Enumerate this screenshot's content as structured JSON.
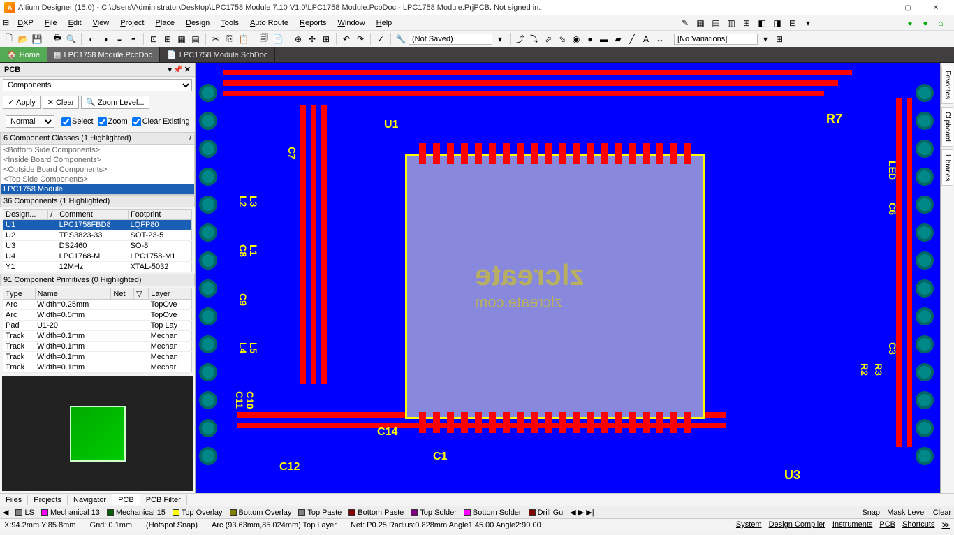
{
  "title": "Altium Designer (15.0) - C:\\Users\\Administrator\\Desktop\\LPC1758 Module 7.10 V1.0\\LPC1758 Module.PcbDoc - LPC1758 Module.PrjPCB. Not signed in.",
  "menus": [
    "DXP",
    "File",
    "Edit",
    "View",
    "Project",
    "Place",
    "Design",
    "Tools",
    "Auto Route",
    "Reports",
    "Window",
    "Help"
  ],
  "toolbar2": {
    "notsaved": "(Not Saved)",
    "novar": "[No Variations]"
  },
  "doctabs": {
    "home": "Home",
    "t1": "LPC1758 Module.PcbDoc",
    "t2": "LPC1758 Module.SchDoc"
  },
  "panel": {
    "title": "PCB",
    "mode": "Components",
    "apply": "Apply",
    "clear": "Clear",
    "zoom": "Zoom Level...",
    "normal": "Normal",
    "select": "Select",
    "zoom2": "Zoom",
    "clearex": "Clear Existing",
    "classes_hdr": "6 Component Classes (1 Highlighted)",
    "classes": [
      "<Bottom Side Components>",
      "<Inside Board Components>",
      "<Outside Board Components>",
      "<Top Side Components>",
      "LPC1758 Module"
    ],
    "comps_hdr": "36 Components (1 Highlighted)",
    "comp_cols": [
      "Design...",
      "Comment",
      "Footprint"
    ],
    "comps": [
      {
        "d": "U1",
        "c": "LPC1758FBD8",
        "f": "LQFP80",
        "sel": true
      },
      {
        "d": "U2",
        "c": "TPS3823-33",
        "f": "SOT-23-5"
      },
      {
        "d": "U3",
        "c": "DS2460",
        "f": "SO-8"
      },
      {
        "d": "U4",
        "c": "LPC1768-M",
        "f": "LPC1758-M1"
      },
      {
        "d": "Y1",
        "c": "12MHz",
        "f": "XTAL-5032"
      }
    ],
    "prims_hdr": "91 Component Primitives (0 Highlighted)",
    "prim_cols": [
      "Type",
      "Name",
      "Net",
      "Layer"
    ],
    "prims": [
      {
        "t": "Arc",
        "n": "Width=0.25mm",
        "e": "",
        "l": "TopOve"
      },
      {
        "t": "Arc",
        "n": "Width=0.5mm",
        "e": "",
        "l": "TopOve"
      },
      {
        "t": "Pad",
        "n": "U1-20",
        "e": "",
        "l": "Top Lay"
      },
      {
        "t": "Track",
        "n": "Width=0.1mm",
        "e": "",
        "l": "Mechan"
      },
      {
        "t": "Track",
        "n": "Width=0.1mm",
        "e": "",
        "l": "Mechan"
      },
      {
        "t": "Track",
        "n": "Width=0.1mm",
        "e": "",
        "l": "Mechan"
      },
      {
        "t": "Track",
        "n": "Width=0.1mm",
        "e": "",
        "l": "Mechar"
      }
    ]
  },
  "bottabs": [
    "Files",
    "Projects",
    "Navigator",
    "PCB",
    "PCB Filter"
  ],
  "bottabs_active": 3,
  "layers": [
    {
      "n": "LS",
      "c": "#808080"
    },
    {
      "n": "Mechanical 13",
      "c": "#ff00ff"
    },
    {
      "n": "Mechanical 15",
      "c": "#006000"
    },
    {
      "n": "Top Overlay",
      "c": "#ffff00"
    },
    {
      "n": "Bottom Overlay",
      "c": "#808000"
    },
    {
      "n": "Top Paste",
      "c": "#808080"
    },
    {
      "n": "Bottom Paste",
      "c": "#800000"
    },
    {
      "n": "Top Solder",
      "c": "#800080"
    },
    {
      "n": "Bottom Solder",
      "c": "#ff00ff"
    },
    {
      "n": "Drill Gu",
      "c": "#800000"
    }
  ],
  "layerbtns": [
    "Snap",
    "Mask Level",
    "Clear"
  ],
  "status": {
    "coord": "X:94.2mm Y:85.8mm",
    "grid": "Grid: 0.1mm",
    "snap": "(Hotspot Snap)",
    "obj": "Arc (93.63mm,85.024mm)  Top Layer",
    "net": "Net: P0.25 Radius:0.828mm Angle1:45.00 Angle2:90.00",
    "right": [
      "System",
      "Design Compiler",
      "Instruments",
      "PCB",
      "Shortcuts"
    ]
  },
  "vtabs": [
    "Favorites",
    "Clipboard",
    "Libraries"
  ],
  "silkrefs": {
    "u1": "U1",
    "r7": "R7",
    "c14": "C14",
    "c1": "C1",
    "c12": "C12",
    "u3": "U3",
    "led": "LED",
    "c6": "C6",
    "c3": "C3",
    "r2": "R2",
    "r3": "R3",
    "c7": "C7",
    "l2": "L2",
    "l3": "L3",
    "c8": "C8",
    "l1": "L1",
    "c9": "C9",
    "l4": "L4",
    "l5": "L5",
    "c11": "C11",
    "c10": "C10",
    "wm1": "zlcreate",
    "wm2": "zlcreate.com"
  }
}
